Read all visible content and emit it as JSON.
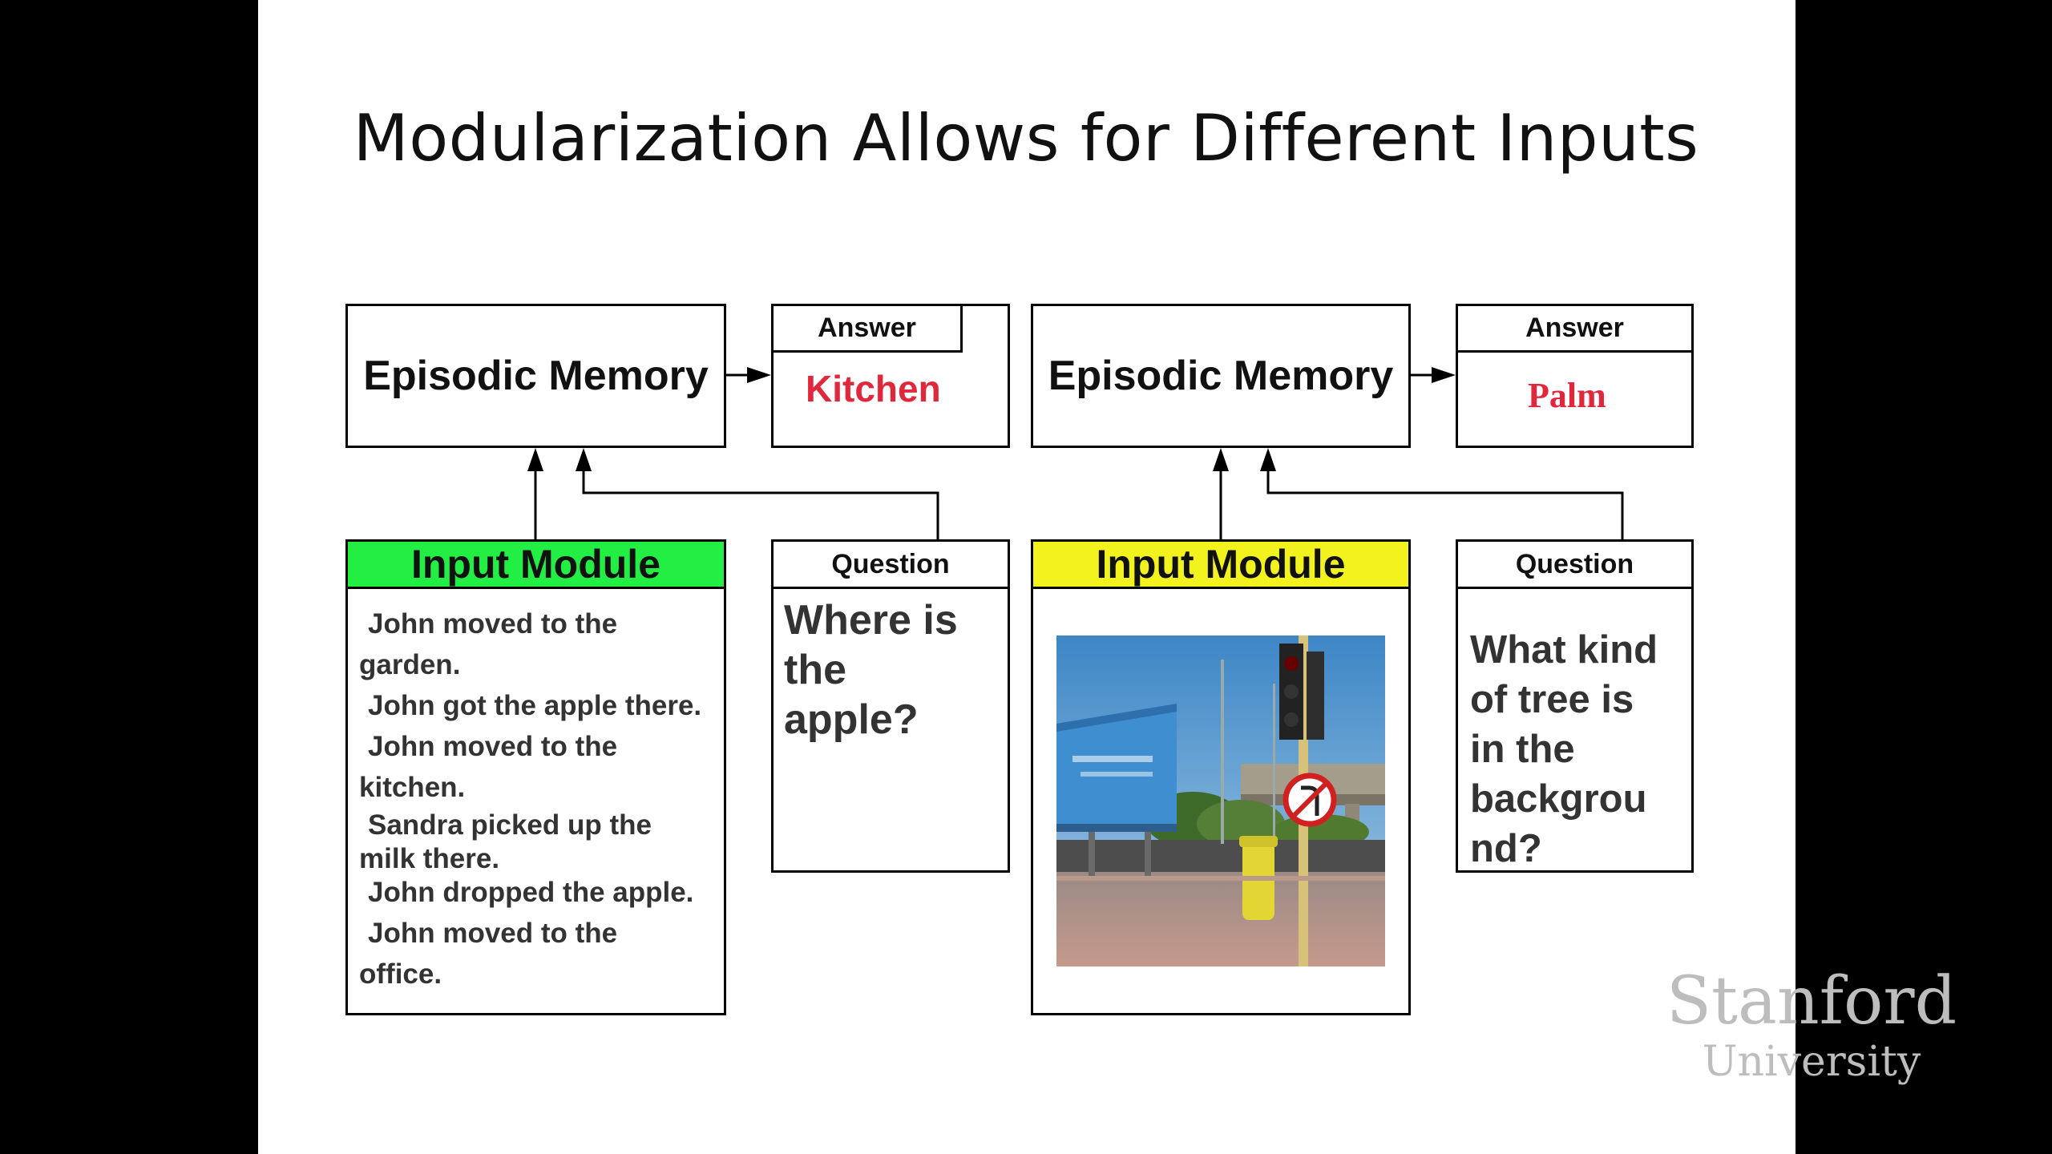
{
  "slide": {
    "title": "Modularization Allows for Different Inputs"
  },
  "left": {
    "memory_label": "Episodic Memory",
    "answer_tab": "Answer",
    "answer": "Kitchen",
    "input_header": "Input Module",
    "input_color": "#22ee44",
    "story_lines": [
      "John moved to the",
      "garden.",
      "John got the apple there.",
      "John moved to the",
      "kitchen.",
      "Sandra picked up the",
      "milk there.",
      "John dropped the apple.",
      "John moved to the",
      "office."
    ],
    "question_tab": "Question",
    "question_lines": [
      "Where is",
      "the",
      "apple?"
    ]
  },
  "right": {
    "memory_label": "Episodic Memory",
    "answer_tab": "Answer",
    "answer": "Palm",
    "input_header": "Input Module",
    "input_color": "#f2f21e",
    "question_tab": "Question",
    "question_lines": [
      "What kind",
      "of tree is",
      "in the",
      "backgrou",
      "nd?"
    ]
  },
  "logo": {
    "line1": "Stanford",
    "line2": "University"
  },
  "colors": {
    "answer_red": "#e0283c",
    "background": "#000000",
    "slide": "#ffffff"
  }
}
